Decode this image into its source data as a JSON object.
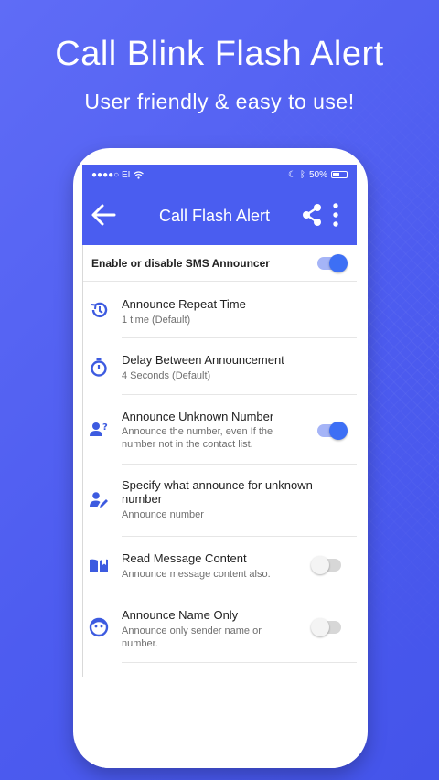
{
  "promo": {
    "title": "Call Blink Flash Alert",
    "subtitle": "User friendly & easy to use!"
  },
  "status_bar": {
    "carrier": "●●●●○ EI",
    "battery_text": "50%",
    "battery_level": 0.5
  },
  "app_bar": {
    "title": "Call Flash Alert",
    "back_icon": "back-arrow-icon",
    "share_icon": "share-icon",
    "more_icon": "more-vertical-icon"
  },
  "sms_announcer": {
    "label": "Enable or disable SMS Announcer",
    "enabled": true
  },
  "settings": [
    {
      "icon": "history-icon",
      "title": "Announce Repeat Time",
      "desc": "1 time (Default)"
    },
    {
      "icon": "stopwatch-icon",
      "title": "Delay Between Announcement",
      "desc": "4 Seconds (Default)"
    },
    {
      "icon": "unknown-user-icon",
      "title": "Announce Unknown Number",
      "desc": "Announce the number, even If the number not in the contact list.",
      "toggle": true
    },
    {
      "icon": "user-edit-icon",
      "title": "Specify what announce for unknown number",
      "desc": "Announce number"
    },
    {
      "icon": "book-icon",
      "title": "Read Message Content",
      "desc": "Announce message content also.",
      "toggle": false
    },
    {
      "icon": "face-icon",
      "title": "Announce Name Only",
      "desc": "Announce only sender name or number.",
      "toggle": false
    }
  ],
  "colors": {
    "primary": "#4a5df0",
    "toggle_on": "#3d6ff5",
    "icon": "#3d5be0"
  }
}
